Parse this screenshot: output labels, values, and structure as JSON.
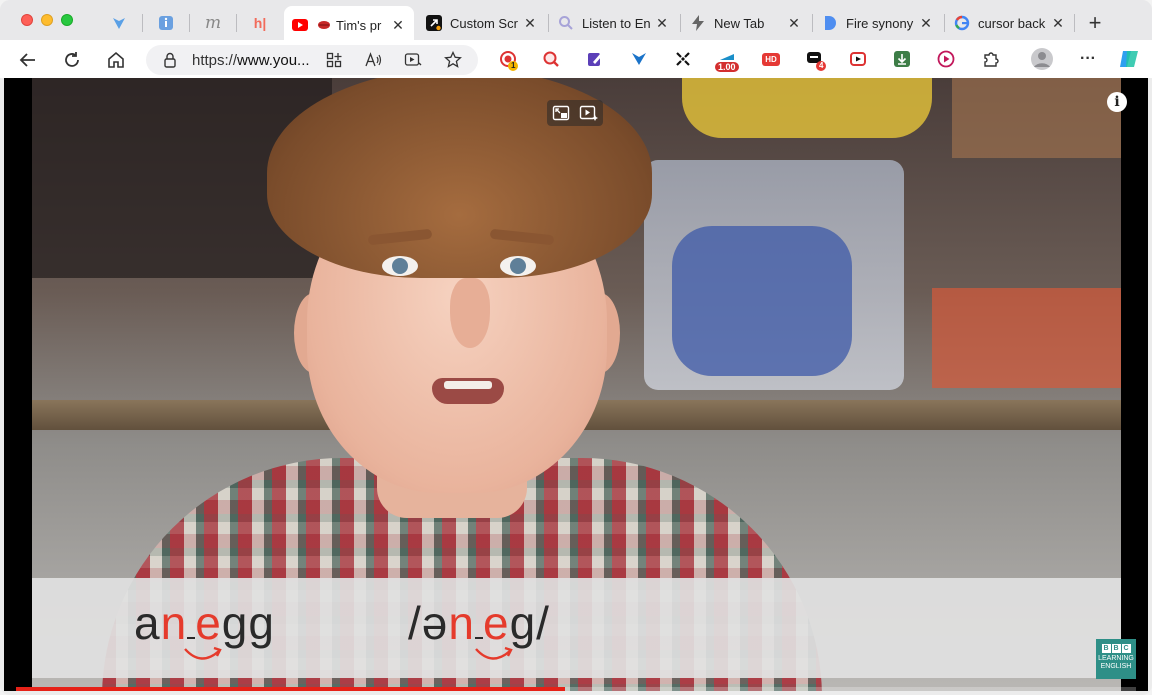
{
  "browser": {
    "pinned_tabs": [
      {
        "icon": "vpn-shield-icon"
      },
      {
        "icon": "info-page-icon"
      },
      {
        "icon": "m-letter-icon"
      },
      {
        "icon": "hj-logo-icon"
      }
    ],
    "tabs": [
      {
        "title": "Tim's pr",
        "icon": "youtube-icon",
        "active": true,
        "audio_icon": "speaker-lips-icon"
      },
      {
        "title": "Custom Scr",
        "icon": "custom-cursor-icon",
        "active": false
      },
      {
        "title": "Listen to En",
        "icon": "search-magnifier-icon",
        "active": false
      },
      {
        "title": "New Tab",
        "icon": "bolt-icon",
        "active": false
      },
      {
        "title": "Fire synony",
        "icon": "d-letter-icon",
        "active": false
      },
      {
        "title": "cursor back",
        "icon": "google-icon",
        "active": false
      }
    ],
    "new_tab_label": "+",
    "address": {
      "url_prefix": "https://",
      "url_host": "www.you..."
    },
    "extensions": [
      {
        "icon": "record-ext-icon",
        "badge": "1"
      },
      {
        "icon": "zoom-ext-icon"
      },
      {
        "icon": "pen-ext-icon"
      },
      {
        "icon": "v-ext-icon"
      },
      {
        "icon": "arrows-ext-icon"
      },
      {
        "icon": "speed-ext-icon",
        "badge": "1.00"
      },
      {
        "icon": "hd-ext-icon",
        "badge": "HD"
      },
      {
        "icon": "chat-ext-icon",
        "badge": "4"
      },
      {
        "icon": "video-ext-icon"
      },
      {
        "icon": "download-ext-icon"
      },
      {
        "icon": "play-ext-icon"
      },
      {
        "icon": "puzzle-icon"
      }
    ],
    "more_label": "···"
  },
  "video": {
    "caption_left": {
      "pre": "a",
      "hl1": "n",
      "gap": "",
      "hl2": "e",
      "post": "gg"
    },
    "caption_right": {
      "pre": "/ə",
      "hl1": "n",
      "hl2": "e",
      "post": "g/"
    },
    "info_label": "i",
    "logo": {
      "letters": [
        "B",
        "B",
        "C"
      ],
      "line1": "LEARNING",
      "line2": "ENGLISH"
    },
    "progress_fraction": 0.49,
    "colors": {
      "highlight": "#e53b2c",
      "progress": "#e62117",
      "logo": "#2e8f87"
    }
  }
}
